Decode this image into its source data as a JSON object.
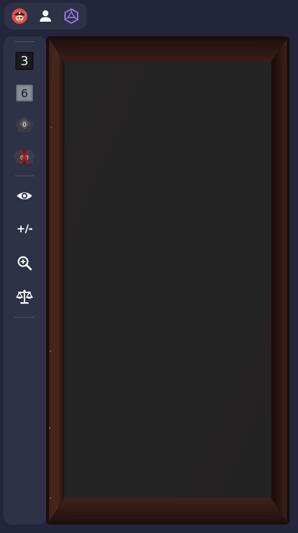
{
  "topbar": {
    "icons": [
      "pirate-icon",
      "user-icon",
      "dice-logo-icon"
    ]
  },
  "sidebar": {
    "dice": [
      {
        "icon": "black-die-icon",
        "value": "3"
      },
      {
        "icon": "gray-die-icon",
        "value": "6"
      },
      {
        "icon": "d10-die-icon",
        "value": "0"
      },
      {
        "icon": "percentile-die-icon",
        "value": "0 0"
      }
    ],
    "tools": [
      {
        "icon": "eye-icon"
      },
      {
        "icon": "plus-minus-icon",
        "label": "+/-"
      },
      {
        "icon": "zoom-in-icon"
      },
      {
        "icon": "scales-icon"
      }
    ]
  },
  "colors": {
    "background": "#23263a",
    "panel": "#2e3247",
    "tray_wood": "#2a1510",
    "tray_felt": "#252424"
  }
}
